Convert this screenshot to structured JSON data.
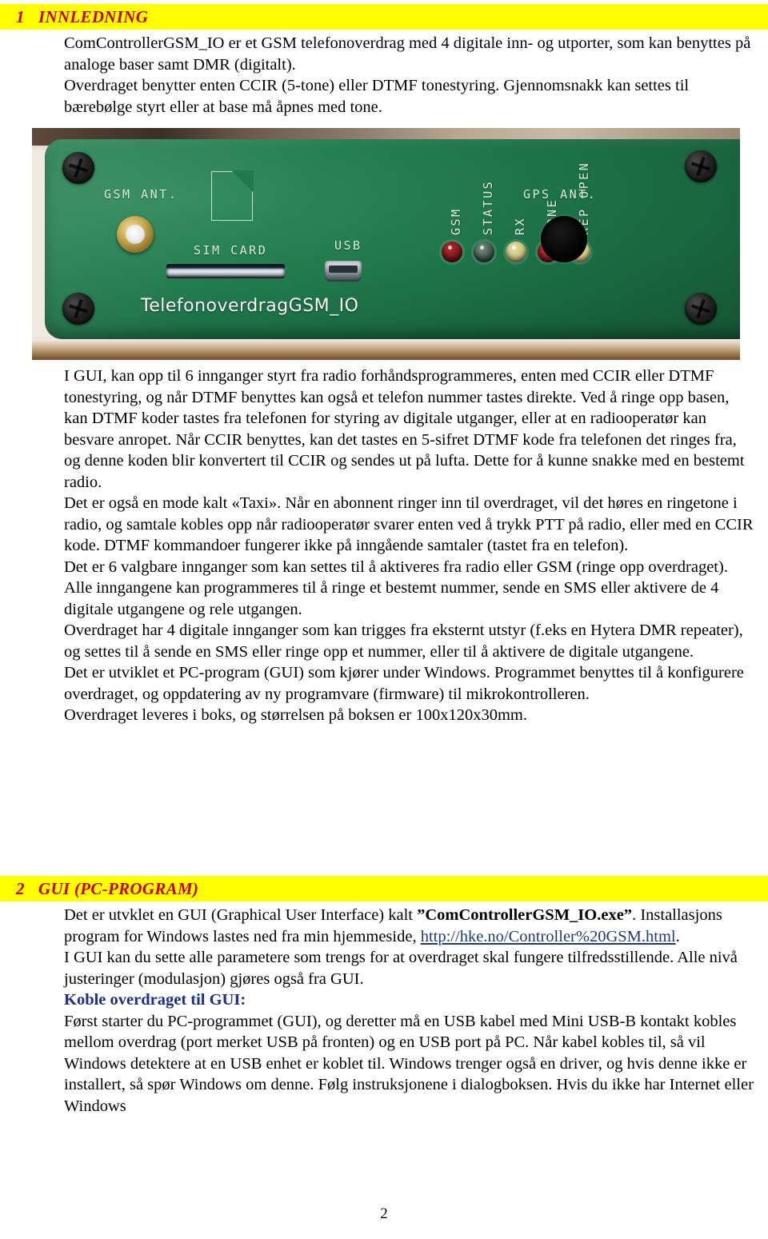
{
  "document": {
    "page_number": "2"
  },
  "sections": [
    {
      "number": "1",
      "title": "INNLEDNING"
    },
    {
      "number": "2",
      "title": "GUI (PC-PROGRAM)"
    }
  ],
  "intro": {
    "paragraph_1": "ComControllerGSM_IO  er et GSM telefonoverdrag med 4 digitale inn- og utporter, som kan benyttes på analoge baser samt DMR (digitalt).",
    "paragraph_2": "Overdraget benytter enten CCIR (5-tone) eller DTMF tonestyring.  Gjennomsnakk kan settes til bærebølge styrt eller at base må åpnes med tone."
  },
  "photo": {
    "caption_alt": "Front panel of TelefonoverdragGSM_IO unit",
    "labels": {
      "gsm_ant": "GSM ANT.",
      "sim_card": "SIM CARD",
      "usb": "USB",
      "brand": "TelefonoverdragGSM_IO",
      "gps_ant": "GPS ANT."
    },
    "leds": [
      {
        "label": "GSM",
        "color": "#7d1418"
      },
      {
        "label": "STATUS",
        "color": "#42564c"
      },
      {
        "label": "RX",
        "color": "#cdc07a"
      },
      {
        "label": "TONE",
        "color": "#8a1118"
      },
      {
        "label": "REP OPEN",
        "color": "#d4c882"
      }
    ],
    "board_color": "#1f7a4c"
  },
  "body": {
    "paragraph_1": "I GUI, kan opp til 6 innganger styrt fra radio forhåndsprogrammeres, enten med CCIR eller DTMF tonestyring, og når DTMF benyttes kan også et telefon nummer tastes direkte.  Ved å ringe opp basen, kan DTMF koder tastes fra telefonen for styring av digitale utganger, eller at en radiooperatør kan besvare anropet.  Når CCIR benyttes, kan det tastes en 5-sifret DTMF kode fra telefonen det ringes fra, og denne koden blir konvertert til CCIR og sendes ut på lufta.  Dette for å kunne snakke med en bestemt radio.",
    "paragraph_2": "Det er også en mode kalt «Taxi».  Når en abonnent ringer inn til overdraget, vil det høres en ringetone i radio, og samtale kobles opp når radiooperatør svarer enten ved å trykk PTT på radio, eller med en CCIR kode.  DTMF kommandoer fungerer ikke på inngående samtaler (tastet fra en telefon).",
    "paragraph_3": "Det er 6 valgbare innganger som kan settes til å aktiveres fra radio eller GSM (ringe opp overdraget).  Alle inngangene kan programmeres til å ringe et bestemt nummer, sende en SMS eller aktivere de 4 digitale utgangene og rele utgangen.",
    "paragraph_4": "Overdraget har 4 digitale innganger som kan trigges fra eksternt utstyr (f.eks en Hytera DMR repeater), og settes til å sende en SMS eller ringe opp et nummer, eller til å aktivere de digitale utgangene.",
    "paragraph_5": "Det er utviklet et PC-program (GUI) som kjører under Windows.  Programmet benyttes til å konfigurere overdraget, og oppdatering av ny programvare (firmware) til mikrokontrolleren.",
    "paragraph_6": "Overdraget leveres i boks, og størrelsen på boksen er 100x120x30mm."
  },
  "gui_section": {
    "line_1_prefix": "Det er utvklet en GUI (Graphical User Interface) kalt ",
    "exe_name": "”ComControllerGSM_IO.exe”",
    "line_2_mid": ".  Installasjons program for Windows lastes ned fra min hjemmeside, ",
    "link_text": "http://hke.no/Controller%20GSM.html",
    "line_2_end": ".",
    "paragraph_2": "I GUI kan du sette alle parametere som trengs for at overdraget skal fungere tilfredsstillende.  Alle nivå justeringer (modulasjon) gjøres også fra GUI.",
    "subheading": "Koble overdraget til GUI:",
    "paragraph_3": "Først starter du PC-programmet (GUI), og deretter må en USB kabel med Mini USB-B kontakt kobles mellom overdrag (port merket USB på fronten) og en USB port på PC.  Når kabel kobles til, så vil Windows detektere at en USB enhet er koblet til.  Windows trenger også en driver, og hvis denne ikke er installert, så spør Windows om denne.  Følg instruksjonene i dialogboksen.  Hvis du ikke har Internet eller Windows"
  },
  "colors": {
    "heading_bar": "#ffff00",
    "heading_text": "#cc0000",
    "link": "#1f3a7a",
    "subheading": "#1a2f8f"
  }
}
